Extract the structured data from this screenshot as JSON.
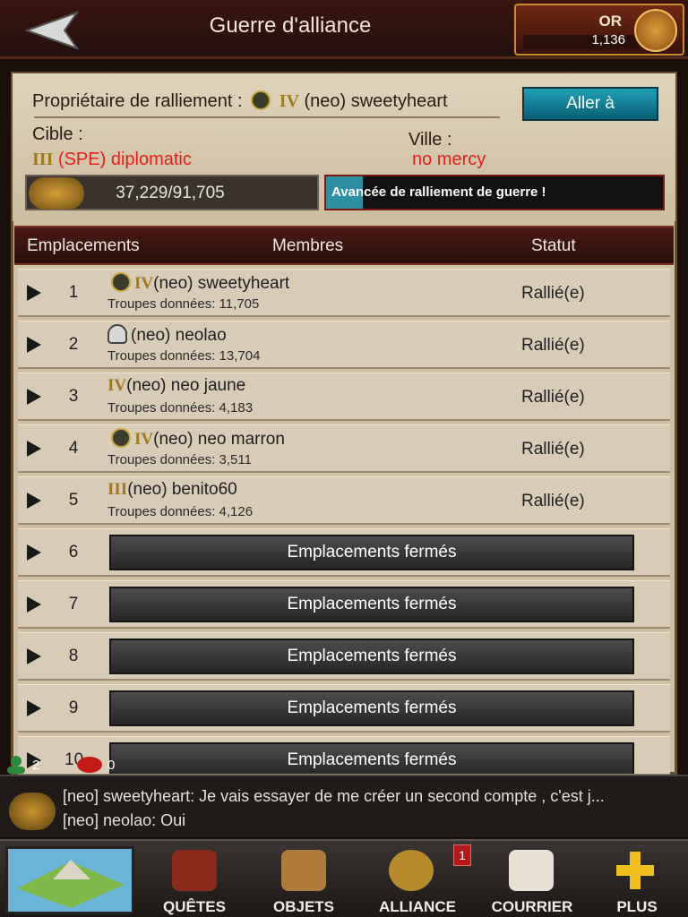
{
  "header": {
    "title": "Guerre d'alliance",
    "gold_label": "OR",
    "gold_value": "1,136"
  },
  "rally": {
    "owner_prefix": "Propriétaire de ralliement :",
    "owner_rank": "IV",
    "owner_name": "(neo) sweetyheart",
    "goto_label": "Aller à",
    "target_label": "Cible :",
    "target_rank": "III",
    "target_name": "(SPE) diplomatic",
    "city_label": "Ville :",
    "city_name": "no mercy",
    "troops": "37,229/91,705",
    "troops_fraction": 0.406,
    "progress_label": "Avancée de ralliement de guerre !",
    "progress_fraction": 0.11
  },
  "table": {
    "headers": [
      "Emplacements",
      "Membres",
      "Statut"
    ],
    "rows": [
      {
        "num": "1",
        "rank": "IV",
        "name": "(neo) sweetyheart",
        "troops": "Troupes données: 11,705",
        "status": "Rallié(e)"
      },
      {
        "num": "2",
        "rank": "",
        "name": "(neo) neolao",
        "troops": "Troupes données: 13,704",
        "status": "Rallié(e)"
      },
      {
        "num": "3",
        "rank": "IV",
        "name": "(neo) neo jaune",
        "troops": "Troupes données: 4,183",
        "status": "Rallié(e)"
      },
      {
        "num": "4",
        "rank": "IV",
        "name": "(neo) neo marron",
        "troops": "Troupes données: 3,511",
        "status": "Rallié(e)"
      },
      {
        "num": "5",
        "rank": "III",
        "name": "(neo) benito60",
        "troops": "Troupes données: 4,126",
        "status": "Rallié(e)"
      }
    ],
    "closed_rows": [
      {
        "num": "6",
        "label": "Emplacements fermés"
      },
      {
        "num": "7",
        "label": "Emplacements fermés"
      },
      {
        "num": "8",
        "label": "Emplacements fermés"
      },
      {
        "num": "9",
        "label": "Emplacements fermés"
      },
      {
        "num": "10",
        "label": "Emplacements fermés"
      }
    ]
  },
  "chat": {
    "online_count": "2",
    "message_count": "0",
    "messages": [
      "[neo] sweetyheart: Je vais essayer de me créer un second compte , c'est j...",
      "[neo] neolao: Oui"
    ]
  },
  "nav": {
    "items": [
      {
        "label": "QUÊTES",
        "icon": "helmet-icon"
      },
      {
        "label": "OBJETS",
        "icon": "bag-icon"
      },
      {
        "label": "ALLIANCE",
        "icon": "alliance-icon",
        "badge": "1"
      },
      {
        "label": "COURRIER",
        "icon": "mail-icon"
      },
      {
        "label": "PLUS",
        "icon": "plus-icon"
      }
    ]
  },
  "colors": {
    "accent": "#2f8ea1",
    "enemy_text": "#e5201a",
    "rank_gold": "#a07a1e"
  }
}
